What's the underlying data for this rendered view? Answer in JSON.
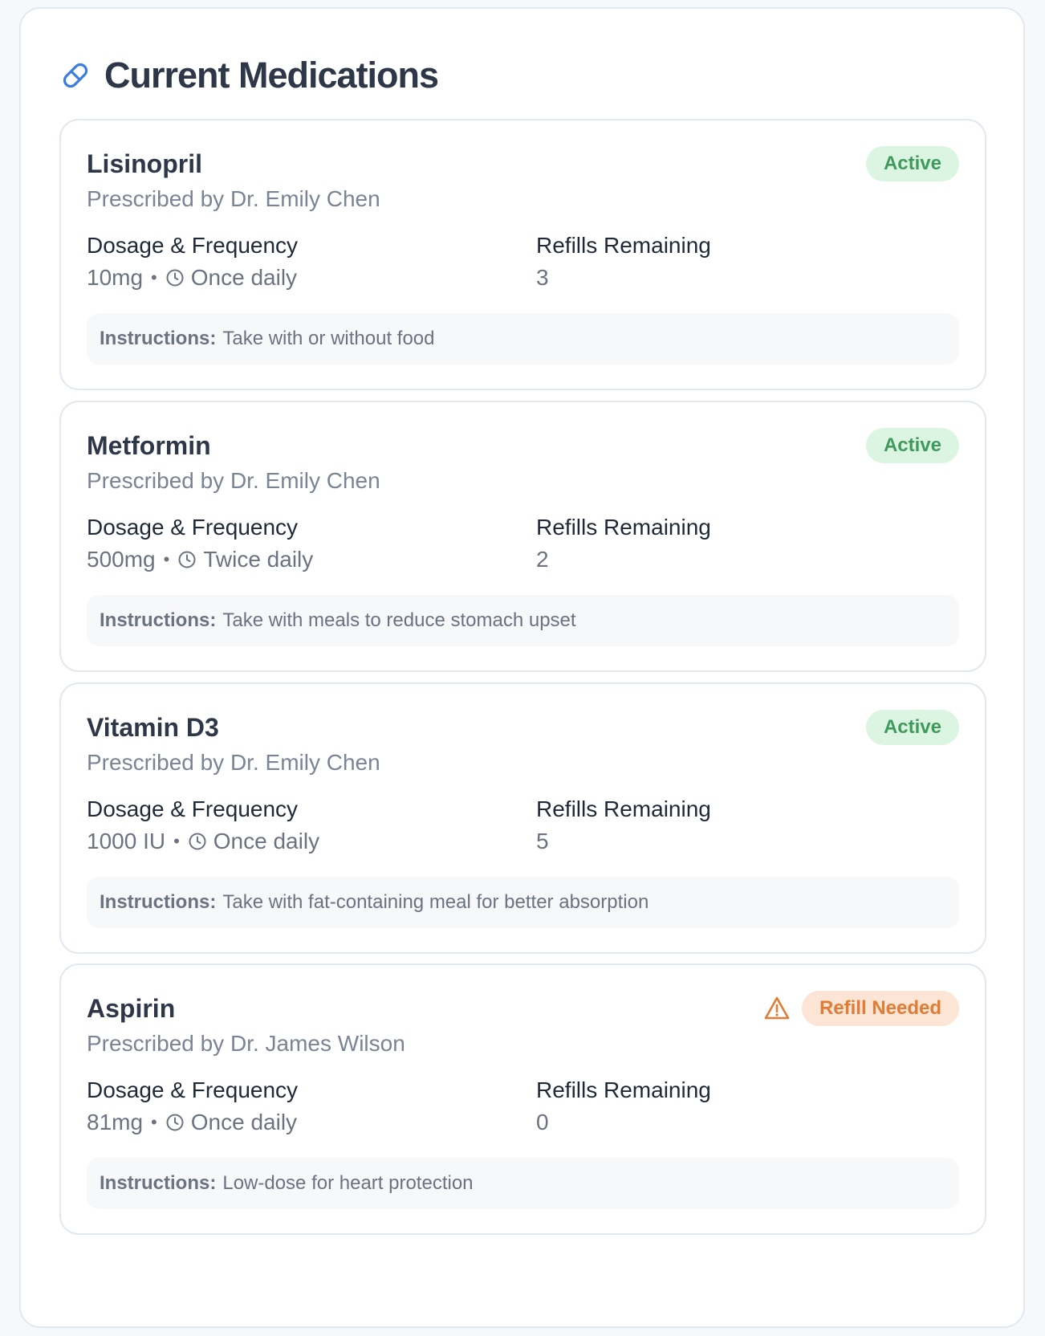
{
  "header": {
    "title": "Current Medications",
    "icon": "pill-icon"
  },
  "colors": {
    "accent": "#3b7de0",
    "active_bg": "#dcf5e3",
    "active_text": "#3f9a5b",
    "refill_bg": "#fce5d4",
    "refill_text": "#e07c35"
  },
  "labels": {
    "dosage_frequency": "Dosage & Frequency",
    "refills_remaining": "Refills Remaining",
    "instructions": "Instructions:",
    "separator": "•"
  },
  "medications": [
    {
      "name": "Lisinopril",
      "prescriber": "Prescribed by Dr. Emily Chen",
      "status": "Active",
      "dosage": "10mg",
      "frequency": "Once daily",
      "refills": "3",
      "instructions": "Take with or without food"
    },
    {
      "name": "Metformin",
      "prescriber": "Prescribed by Dr. Emily Chen",
      "status": "Active",
      "dosage": "500mg",
      "frequency": "Twice daily",
      "refills": "2",
      "instructions": "Take with meals to reduce stomach upset"
    },
    {
      "name": "Vitamin D3",
      "prescriber": "Prescribed by Dr. Emily Chen",
      "status": "Active",
      "dosage": "1000 IU",
      "frequency": "Once daily",
      "refills": "5",
      "instructions": "Take with fat-containing meal for better absorption"
    },
    {
      "name": "Aspirin",
      "prescriber": "Prescribed by Dr. James Wilson",
      "status": "Refill Needed",
      "status_icon": "warning-icon",
      "dosage": "81mg",
      "frequency": "Once daily",
      "refills": "0",
      "instructions": "Low-dose for heart protection"
    }
  ]
}
